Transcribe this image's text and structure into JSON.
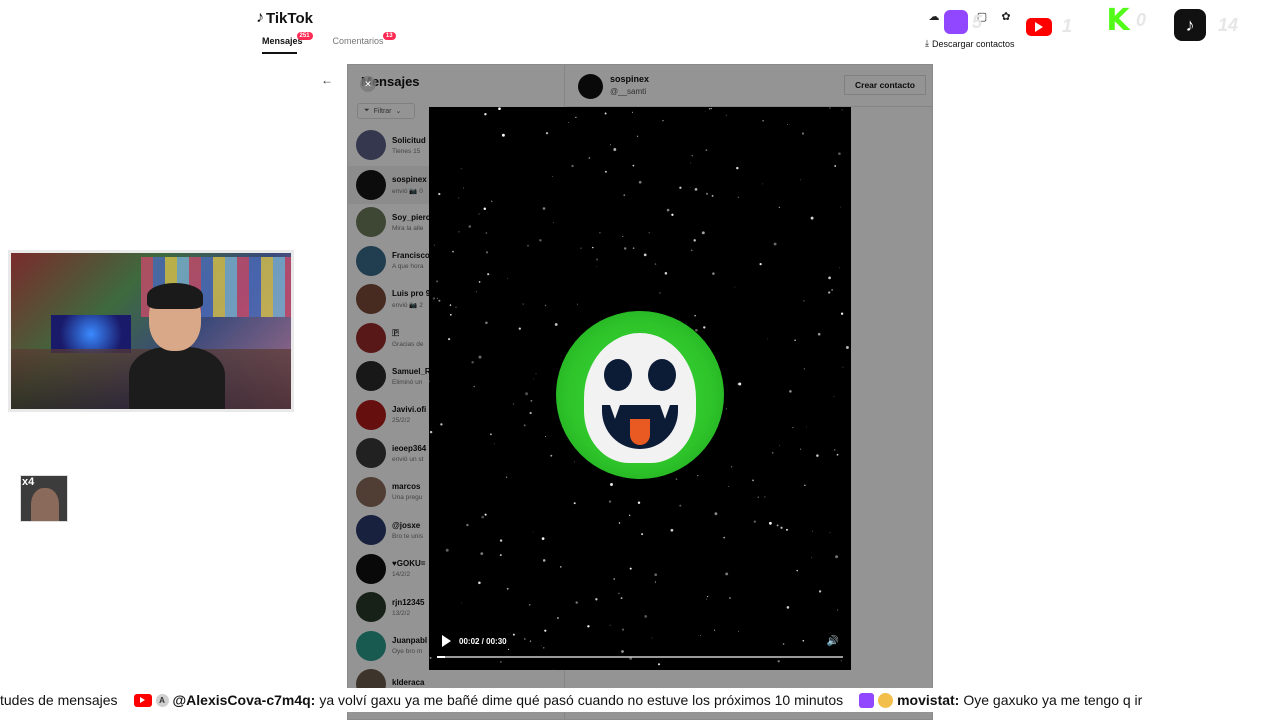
{
  "app": {
    "title": "TikTok",
    "logo_note": "♪"
  },
  "tabs": [
    {
      "label": "Mensajes",
      "badge": "251"
    },
    {
      "label": "Comentarios",
      "badge": "13"
    }
  ],
  "top_icons": [
    "cloud-upload-icon",
    "inbox-icon",
    "message-icon",
    "settings-icon"
  ],
  "download_contacts": "Descargar contactos",
  "overlay": {
    "twitch_count": "5",
    "youtube_count": "1",
    "kick_count": "0",
    "tiktok_count": "14"
  },
  "messages": {
    "title": "Mensajes",
    "filter_label": "Filtrar",
    "conversations": [
      {
        "name": "Solicitud",
        "preview": "Tienes 15"
      },
      {
        "name": "sospinex",
        "preview": "envió 📷 0"
      },
      {
        "name": "Soy_pierc",
        "preview": "Mira la alle"
      },
      {
        "name": "Francisco",
        "preview": "A que hora"
      },
      {
        "name": "Luis pro 9",
        "preview": "envió 📷 2"
      },
      {
        "name": "🇵",
        "preview": "Gracias de"
      },
      {
        "name": "Samuel_R",
        "preview": "Eliminó un"
      },
      {
        "name": "Javivi.ofi",
        "preview": "25/2/2"
      },
      {
        "name": "ieoep364",
        "preview": "envió un st"
      },
      {
        "name": "marcos",
        "preview": "Una pregu"
      },
      {
        "name": "@josxe",
        "preview": "Bro te unis"
      },
      {
        "name": "♥GOKU=",
        "preview": "14/2/2"
      },
      {
        "name": "rjn12345",
        "preview": "13/2/2"
      },
      {
        "name": "Juanpabl",
        "preview": "Oye bro m"
      },
      {
        "name": "klderaca",
        "preview": ""
      }
    ]
  },
  "chat": {
    "name": "sospinex",
    "handle": "@__samti",
    "create_contact": "Crear contacto"
  },
  "video": {
    "time": "00:02 / 00:30",
    "progress": 0.02
  },
  "thumb_label": "x4",
  "ticker": {
    "lead": "tudes de mensajes",
    "msg1_user": "@AlexisCova-c7m4q:",
    "msg1_text": "ya volví gaxu ya me bañé dime qué pasó cuando no estuve los próximos 10 minutos",
    "msg2_user": "movistat:",
    "msg2_text": "Oye gaxuko ya me tengo q ir",
    "badge_letter": "A"
  }
}
